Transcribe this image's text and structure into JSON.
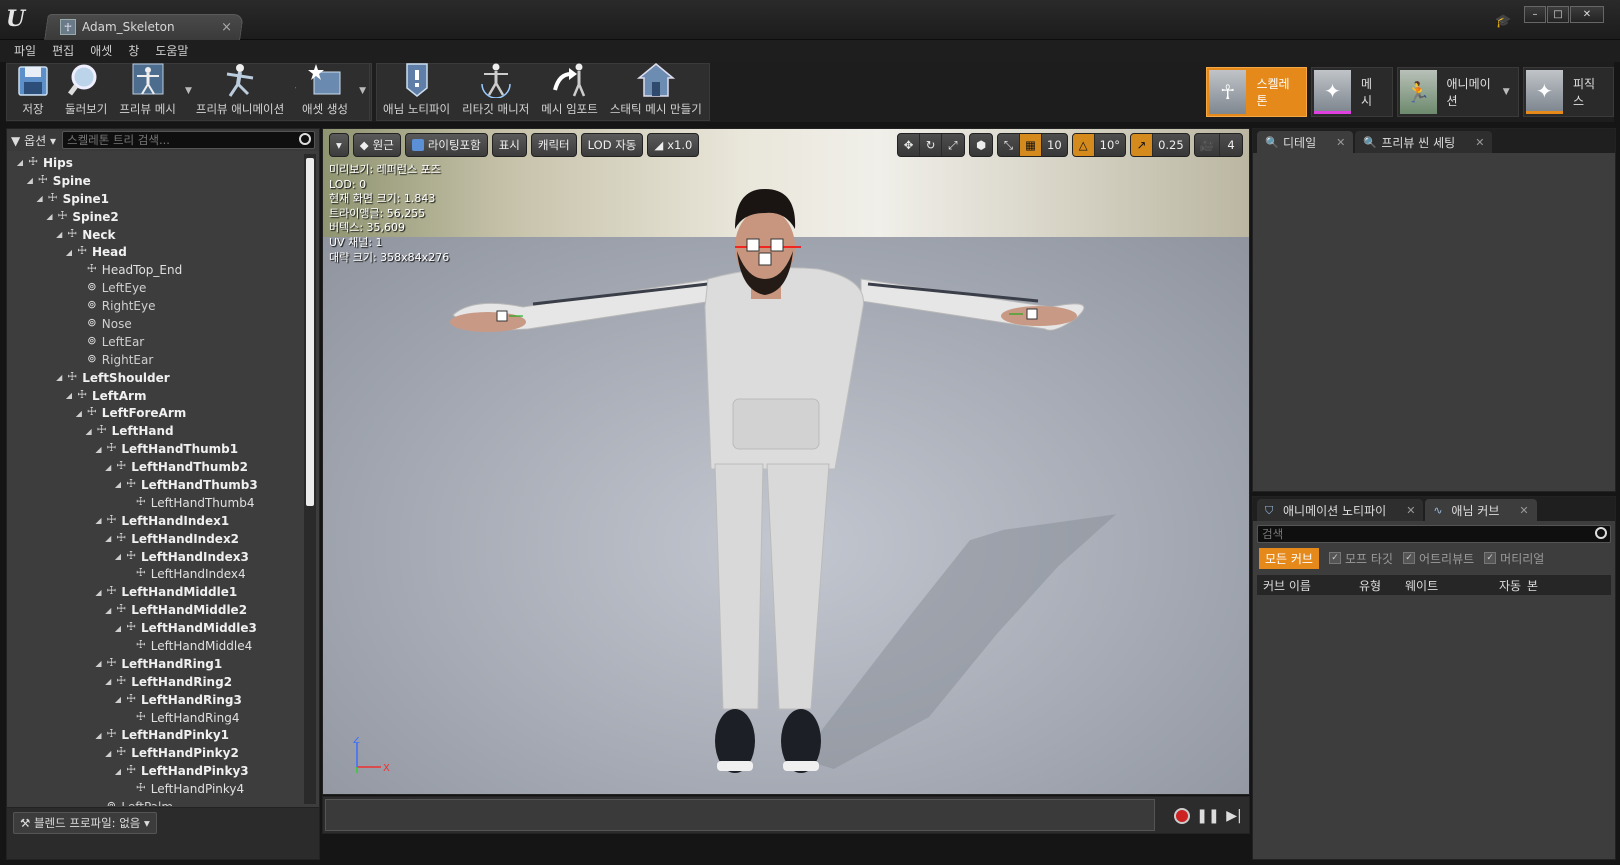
{
  "window": {
    "tab_title": "Adam_Skeleton",
    "tab_close": "×",
    "min": "–",
    "max": "□",
    "close": "✕"
  },
  "menu": [
    "파일",
    "편집",
    "애셋",
    "창",
    "도움말"
  ],
  "toolbar": {
    "save": "저장",
    "browse": "둘러보기",
    "preview_mesh": "프리뷰 메시",
    "preview_anim": "프리뷰 애니메이션",
    "create_asset": "애셋 생성",
    "anim_notify": "애님 노티파이",
    "retarget": "리타깃 매니저",
    "import_mesh": "메시 임포트",
    "make_static": "스태틱 메시 만들기"
  },
  "modes": {
    "skeleton": "스켈레톤",
    "mesh": "메시",
    "animation": "애니메이션",
    "physics": "피직스"
  },
  "skeleton_tree": {
    "options": "옵션",
    "search_placeholder": "스켈레톤 트리 검색...",
    "items": [
      {
        "name": "Hips",
        "depth": 0,
        "type": "bone"
      },
      {
        "name": "Spine",
        "depth": 1,
        "type": "bone"
      },
      {
        "name": "Spine1",
        "depth": 2,
        "type": "bone"
      },
      {
        "name": "Spine2",
        "depth": 3,
        "type": "bone"
      },
      {
        "name": "Neck",
        "depth": 4,
        "type": "bone"
      },
      {
        "name": "Head",
        "depth": 5,
        "type": "bone"
      },
      {
        "name": "HeadTop_End",
        "depth": 6,
        "type": "leaf"
      },
      {
        "name": "LeftEye",
        "depth": 6,
        "type": "socket"
      },
      {
        "name": "RightEye",
        "depth": 6,
        "type": "socket"
      },
      {
        "name": "Nose",
        "depth": 6,
        "type": "socket"
      },
      {
        "name": "LeftEar",
        "depth": 6,
        "type": "socket"
      },
      {
        "name": "RightEar",
        "depth": 6,
        "type": "socket"
      },
      {
        "name": "LeftShoulder",
        "depth": 4,
        "type": "bone"
      },
      {
        "name": "LeftArm",
        "depth": 5,
        "type": "bone"
      },
      {
        "name": "LeftForeArm",
        "depth": 6,
        "type": "bone"
      },
      {
        "name": "LeftHand",
        "depth": 7,
        "type": "bone"
      },
      {
        "name": "LeftHandThumb1",
        "depth": 8,
        "type": "bone"
      },
      {
        "name": "LeftHandThumb2",
        "depth": 9,
        "type": "bone"
      },
      {
        "name": "LeftHandThumb3",
        "depth": 10,
        "type": "bone"
      },
      {
        "name": "LeftHandThumb4",
        "depth": 11,
        "type": "leaf"
      },
      {
        "name": "LeftHandIndex1",
        "depth": 8,
        "type": "bone"
      },
      {
        "name": "LeftHandIndex2",
        "depth": 9,
        "type": "bone"
      },
      {
        "name": "LeftHandIndex3",
        "depth": 10,
        "type": "bone"
      },
      {
        "name": "LeftHandIndex4",
        "depth": 11,
        "type": "leaf"
      },
      {
        "name": "LeftHandMiddle1",
        "depth": 8,
        "type": "bone"
      },
      {
        "name": "LeftHandMiddle2",
        "depth": 9,
        "type": "bone"
      },
      {
        "name": "LeftHandMiddle3",
        "depth": 10,
        "type": "bone"
      },
      {
        "name": "LeftHandMiddle4",
        "depth": 11,
        "type": "leaf"
      },
      {
        "name": "LeftHandRing1",
        "depth": 8,
        "type": "bone"
      },
      {
        "name": "LeftHandRing2",
        "depth": 9,
        "type": "bone"
      },
      {
        "name": "LeftHandRing3",
        "depth": 10,
        "type": "bone"
      },
      {
        "name": "LeftHandRing4",
        "depth": 11,
        "type": "leaf"
      },
      {
        "name": "LeftHandPinky1",
        "depth": 8,
        "type": "bone"
      },
      {
        "name": "LeftHandPinky2",
        "depth": 9,
        "type": "bone"
      },
      {
        "name": "LeftHandPinky3",
        "depth": 10,
        "type": "bone"
      },
      {
        "name": "LeftHandPinky4",
        "depth": 11,
        "type": "leaf"
      },
      {
        "name": "LeftPalm",
        "depth": 8,
        "type": "socket"
      }
    ],
    "blend_profile": "블렌드 프로파일: 없음"
  },
  "viewport": {
    "perspective": "원근",
    "lighting": "라이팅포함",
    "show": "표시",
    "character": "캐릭터",
    "lod": "LOD 자동",
    "speed": "x1.0",
    "grid_snap": "10",
    "rot_snap": "10°",
    "scale_snap": "0.25",
    "cam_speed": "4",
    "stats": [
      "미리보기: 레퍼런스 포즈",
      "LOD: 0",
      "현재 화면 크기: 1.843",
      "트라이앵글: 56,255",
      "버텍스: 35,609",
      "UV 채널: 1",
      "대략 크기: 358x84x276"
    ],
    "axis_z": "Z",
    "axis_x": "X"
  },
  "right_top": {
    "tab1": "디테일",
    "tab2": "프리뷰 씬 세팅"
  },
  "right_bottom": {
    "tab1": "애니메이션 노티파이",
    "tab2": "애님 커브",
    "search_placeholder": "검색",
    "all_curves": "모든 커브",
    "filters": [
      "모프 타깃",
      "어트리뷰트",
      "머티리얼"
    ],
    "columns": [
      "커브 이름",
      "유형",
      "웨이트",
      "자동",
      "본"
    ]
  },
  "colors": {
    "accent": "#e5891a",
    "panel": "#3d3d3d",
    "bg": "#151515"
  }
}
